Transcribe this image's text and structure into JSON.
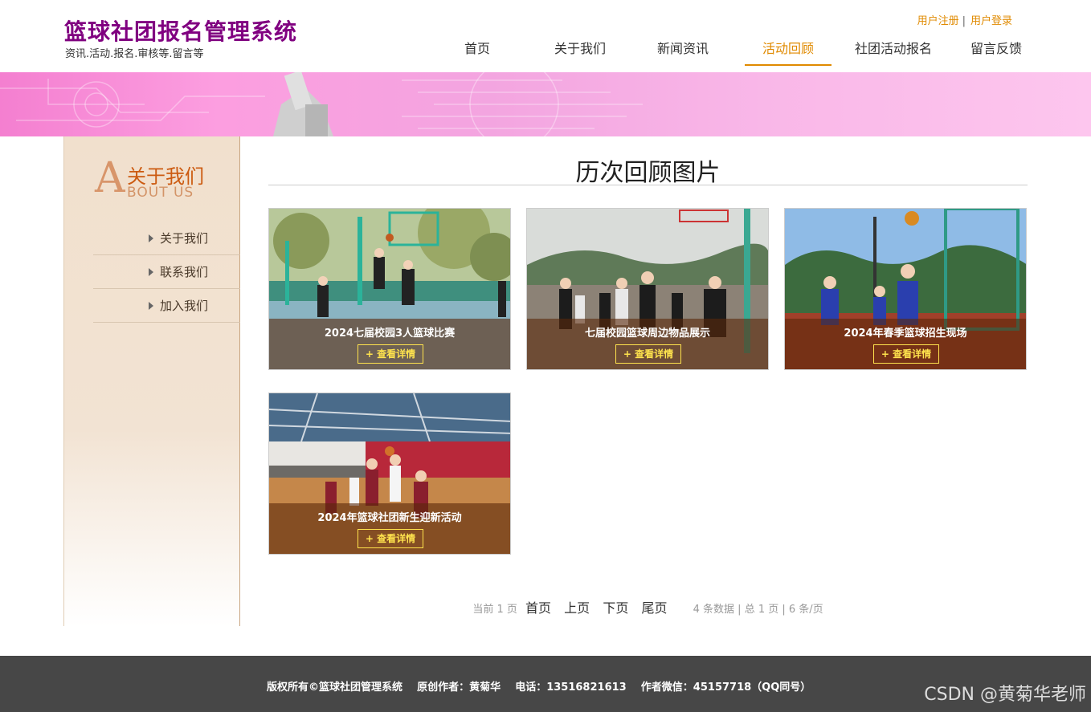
{
  "header": {
    "title": "篮球社团报名管理系统",
    "subtitle": "资讯.活动.报名.审核等.留言等",
    "register_link": "用户注册",
    "login_link": "用户登录",
    "link_separator": "|"
  },
  "nav": {
    "items": [
      "首页",
      "关于我们",
      "新闻资讯",
      "活动回顾",
      "社团活动报名",
      "留言反馈"
    ],
    "active_index": 3
  },
  "sidebar": {
    "logo_letter": "A",
    "logo_cn": "关于我们",
    "logo_en": "BOUT US",
    "items": [
      "关于我们",
      "联系我们",
      "加入我们"
    ]
  },
  "main": {
    "title": "历次回顾图片",
    "detail_label": "+ 查看详情",
    "cards": [
      {
        "caption": "2024七届校园3人篮球比赛"
      },
      {
        "caption": "七届校园篮球周边物品展示"
      },
      {
        "caption": "2024年春季篮球招生现场"
      },
      {
        "caption": "2024年篮球社团新生迎新活动"
      }
    ]
  },
  "pager": {
    "current": "当前 1 页",
    "first": "首页",
    "prev": "上页",
    "next": "下页",
    "last": "尾页",
    "info": "4 条数据 | 总 1 页 | 6 条/页"
  },
  "footer": {
    "text": "版权所有©篮球社团管理系统    原创作者：黄菊华    电话：13516821613    作者微信：45157718（QQ同号）",
    "watermark": "CSDN @黄菊华老师"
  },
  "colors": {
    "brand_title": "#800080",
    "accent": "#e08a00",
    "footer_bg": "#474747",
    "detail_btn": "#ffe34d"
  }
}
